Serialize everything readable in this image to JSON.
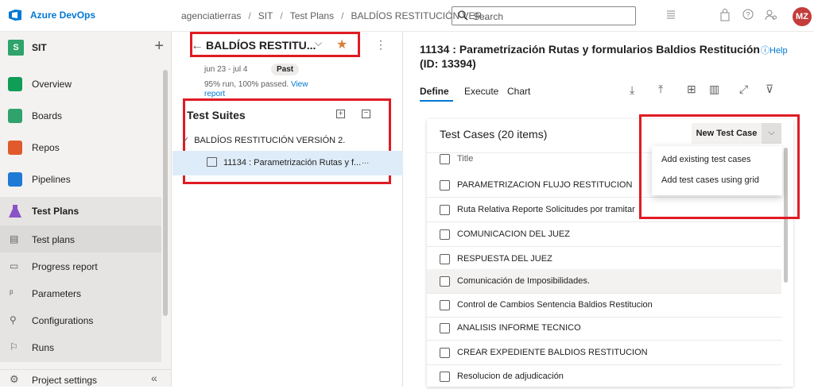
{
  "header": {
    "brand": "Azure DevOps",
    "breadcrumb": [
      "agenciatierras",
      "SIT",
      "Test Plans",
      "BALDÍOS RESTITUCIÓN VER..."
    ],
    "search_placeholder": "Search",
    "avatar_initials": "MZ"
  },
  "sidebar": {
    "project_badge": "S",
    "project_name": "SIT",
    "items": [
      {
        "label": "Overview"
      },
      {
        "label": "Boards"
      },
      {
        "label": "Repos"
      },
      {
        "label": "Pipelines"
      },
      {
        "label": "Test Plans"
      },
      {
        "label": "Test plans"
      },
      {
        "label": "Progress report"
      },
      {
        "label": "Parameters"
      },
      {
        "label": "Configurations"
      },
      {
        "label": "Runs"
      }
    ],
    "settings_label": "Project settings"
  },
  "plan": {
    "title": "BALDÍOS RESTITU...",
    "date_range": "jun 23 - jul 4",
    "status_pill": "Past",
    "summary_text": "95% run, 100% passed.",
    "summary_link_1": "View",
    "summary_link_2": "report"
  },
  "suites": {
    "heading": "Test Suites",
    "root": "BALDÍOS RESTITUCIÓN VERSIÓN 2.",
    "child": "11134 : Parametrización Rutas y f...",
    "child_more": "..."
  },
  "detail": {
    "title_line1": "11134 : Parametrización Rutas y formularios Baldios Restitución",
    "title_line2": "(ID: 13394)",
    "help": "Help",
    "tabs": [
      "Define",
      "Execute",
      "Chart"
    ],
    "cases_title": "Test Cases (20 items)",
    "new_button": "New Test Case",
    "column_title": "Title",
    "menu_items": [
      "Add existing test cases",
      "Add test cases using grid"
    ],
    "cases": [
      "PARAMETRIZACION FLUJO RESTITUCION",
      "Ruta Relativa Reporte Solicitudes por tramitar",
      "COMUNICACION DEL JUEZ",
      "RESPUESTA DEL JUEZ",
      "Comunicación de Imposibilidades.",
      "Control de Cambios Sentencia Baldios Restitucion",
      "ANALISIS INFORME TECNICO",
      "CREAR EXPEDIENTE BALDIOS RESTITUCION",
      "Resolucion de adjudicación"
    ]
  },
  "colors": {
    "accent": "#0078d4",
    "highlight_box": "#e01b24",
    "favorite_star": "#d67f3c",
    "selected_row": "#deecf9"
  }
}
